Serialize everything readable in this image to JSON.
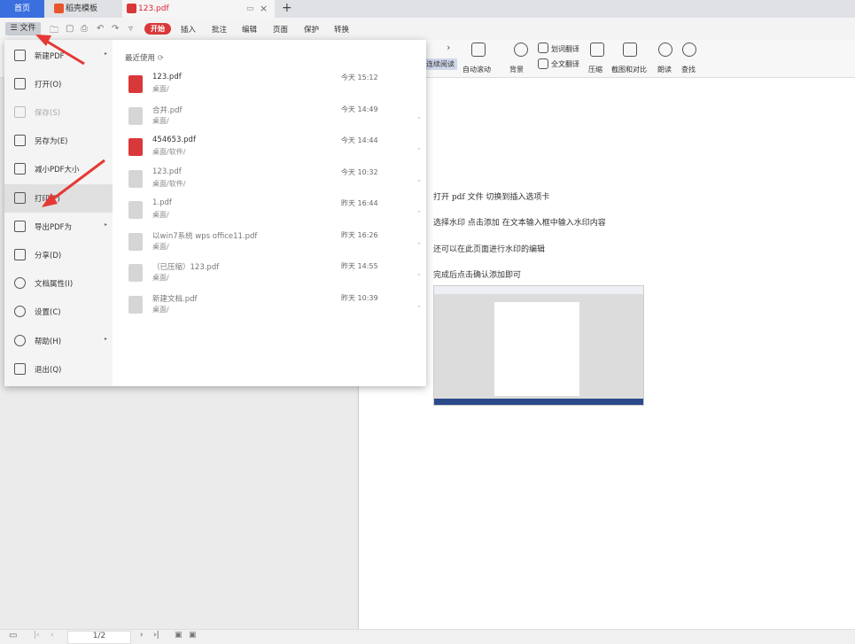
{
  "tabs": {
    "home": "首页",
    "daoke": "稻壳模板",
    "pdf": "123.pdf"
  },
  "menubar": {
    "file": "文件",
    "start": "开始",
    "tabs": [
      "插入",
      "批注",
      "编辑",
      "页面",
      "保护",
      "转换"
    ]
  },
  "ribbon": {
    "tools": [
      "连续阅读",
      "自动滚动",
      "背景",
      "划词翻译",
      "全文翻译",
      "压缩",
      "截图和对比",
      "朗读",
      "查找"
    ]
  },
  "file_menu": {
    "items": [
      {
        "label": "新建PDF",
        "icon": "new-pdf-icon",
        "arrow": true
      },
      {
        "label": "打开(O)",
        "icon": "folder-icon"
      },
      {
        "label": "保存(S)",
        "icon": "save-icon",
        "disabled": true
      },
      {
        "label": "另存为(E)",
        "icon": "save-as-icon"
      },
      {
        "label": "减小PDF大小",
        "icon": "compress-icon"
      },
      {
        "label": "打印(P)",
        "icon": "printer-icon"
      },
      {
        "label": "导出PDF为",
        "icon": "export-icon",
        "arrow": true
      },
      {
        "label": "分享(D)",
        "icon": "share-icon"
      },
      {
        "label": "文档属性(I)",
        "icon": "properties-icon"
      },
      {
        "label": "设置(C)",
        "icon": "gear-icon"
      },
      {
        "label": "帮助(H)",
        "icon": "help-icon",
        "arrow": true
      },
      {
        "label": "退出(Q)",
        "icon": "exit-icon"
      }
    ],
    "recent_title": "最近使用",
    "recent": [
      {
        "name": "123.pdf",
        "path": "桌面/",
        "time": "今天 15:12"
      },
      {
        "name": "合并.pdf",
        "path": "桌面/",
        "time": "今天 14:49"
      },
      {
        "name": "454653.pdf",
        "path": "桌面/软件/",
        "time": "今天 14:44"
      },
      {
        "name": "123.pdf",
        "path": "桌面/软件/",
        "time": "今天 10:32"
      },
      {
        "name": "1.pdf",
        "path": "桌面/",
        "time": "昨天 16:44"
      },
      {
        "name": "以win7系统 wps office11.pdf",
        "path": "桌面/",
        "time": "昨天 16:26"
      },
      {
        "name": "（已压缩）123.pdf",
        "path": "桌面/",
        "time": "昨天 14:55"
      },
      {
        "name": "新建文档.pdf",
        "path": "桌面/",
        "time": "昨天 10:39"
      }
    ]
  },
  "document": {
    "lines": [
      "打开 pdf 文件   切换到插入选项卡",
      "选择水印     点击添加    在文本输入框中输入水印内容",
      "还可以在此页面进行水印的编辑",
      "完成后点击确认添加即可"
    ]
  },
  "statusbar": {
    "page": "1/2"
  },
  "colors": {
    "accent": "#3b6fe0",
    "brand_red": "#d9383a",
    "arrow_red": "#e53935"
  }
}
